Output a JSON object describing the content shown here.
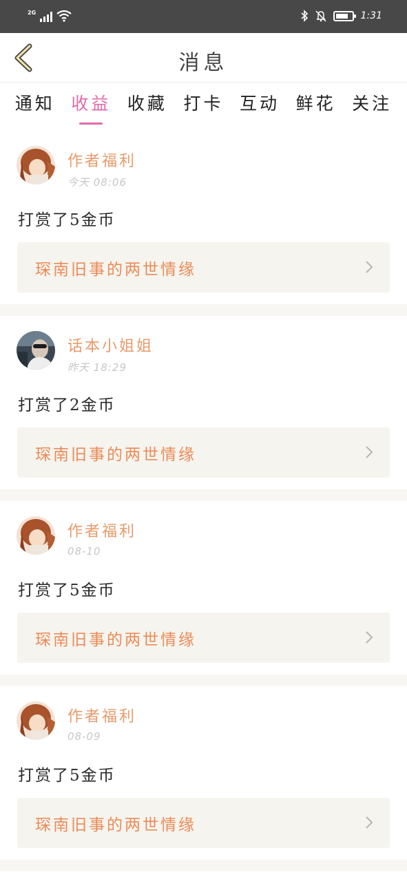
{
  "status_bar": {
    "network": "2G",
    "time": "1:31"
  },
  "header": {
    "title": "消息",
    "back_icon": "chevron-left-icon"
  },
  "tabs": [
    {
      "label": "通知",
      "active": false
    },
    {
      "label": "收益",
      "active": true
    },
    {
      "label": "收藏",
      "active": false
    },
    {
      "label": "打卡",
      "active": false
    },
    {
      "label": "互动",
      "active": false
    },
    {
      "label": "鲜花",
      "active": false
    },
    {
      "label": "关注",
      "active": false
    }
  ],
  "messages": [
    {
      "sender": "作者福利",
      "time": "今天 08:06",
      "text": "打赏了5金币",
      "book": "琛南旧事的两世情缘",
      "avatar": "anime-girl"
    },
    {
      "sender": "话本小姐姐",
      "time": "昨天 18:29",
      "text": "打赏了2金币",
      "book": "琛南旧事的两世情缘",
      "avatar": "photo-person"
    },
    {
      "sender": "作者福利",
      "time": "08-10",
      "text": "打赏了5金币",
      "book": "琛南旧事的两世情缘",
      "avatar": "anime-girl"
    },
    {
      "sender": "作者福利",
      "time": "08-09",
      "text": "打赏了5金币",
      "book": "琛南旧事的两世情缘",
      "avatar": "anime-girl"
    }
  ],
  "colors": {
    "accent_pink": "#e06aa8",
    "sender_orange": "#e89a6a",
    "book_orange": "#ea8b58",
    "status_bar_bg": "#484848",
    "divider": "#f7f6f2"
  }
}
